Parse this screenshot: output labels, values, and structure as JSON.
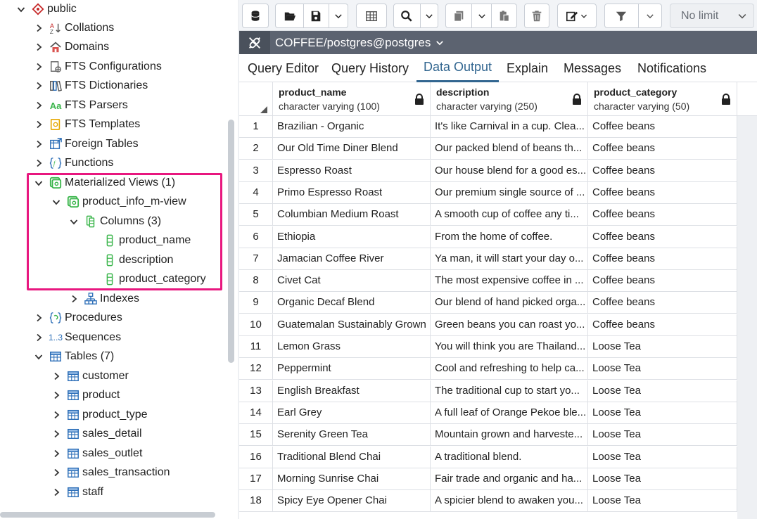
{
  "tree": {
    "items": [
      {
        "label": "public",
        "icon": "schema-icon"
      },
      {
        "label": "Collations",
        "icon": "collation-icon"
      },
      {
        "label": "Domains",
        "icon": "domain-icon"
      },
      {
        "label": "FTS Configurations",
        "icon": "fts-config-icon"
      },
      {
        "label": "FTS Dictionaries",
        "icon": "fts-dictionary-icon"
      },
      {
        "label": "FTS Parsers",
        "icon": "fts-parser-icon"
      },
      {
        "label": "FTS Templates",
        "icon": "fts-template-icon"
      },
      {
        "label": "Foreign Tables",
        "icon": "foreign-table-icon"
      },
      {
        "label": "Functions",
        "icon": "function-icon"
      },
      {
        "label": "Materialized Views (1)",
        "icon": "materialized-view-icon"
      },
      {
        "label": "product_info_m-view",
        "icon": "materialized-view-icon"
      },
      {
        "label": "Columns (3)",
        "icon": "columns-icon"
      },
      {
        "label": "product_name",
        "icon": "column-icon"
      },
      {
        "label": "description",
        "icon": "column-icon"
      },
      {
        "label": "product_category",
        "icon": "column-icon"
      },
      {
        "label": "Indexes",
        "icon": "index-icon"
      },
      {
        "label": "Procedures",
        "icon": "procedure-icon"
      },
      {
        "label": "Sequences",
        "icon": "sequence-icon"
      },
      {
        "label": "Tables (7)",
        "icon": "table-icon"
      },
      {
        "label": "customer",
        "icon": "table-icon"
      },
      {
        "label": "product",
        "icon": "table-icon"
      },
      {
        "label": "product_type",
        "icon": "table-icon"
      },
      {
        "label": "sales_detail",
        "icon": "table-icon"
      },
      {
        "label": "sales_outlet",
        "icon": "table-icon"
      },
      {
        "label": "sales_transaction",
        "icon": "table-icon"
      },
      {
        "label": "staff",
        "icon": "table-icon"
      }
    ],
    "fts_parsers_glyph": "Aa",
    "sequences_glyph": "1..3"
  },
  "toolbar": {
    "limit": "No limit"
  },
  "connection": {
    "label": "COFFEE/postgres@postgres"
  },
  "tabs": [
    "Query Editor",
    "Query History",
    "Data Output",
    "Explain",
    "Messages",
    "Notifications"
  ],
  "active_tab": "Data Output",
  "grid": {
    "columns": [
      {
        "name": "product_name",
        "type": "character varying (100)"
      },
      {
        "name": "description",
        "type": "character varying (250)"
      },
      {
        "name": "product_category",
        "type": "character varying (50)"
      }
    ],
    "rows": [
      [
        "1",
        "Brazilian - Organic",
        "It's like Carnival in a cup. Clea...",
        "Coffee beans"
      ],
      [
        "2",
        "Our Old Time Diner Blend",
        "Our packed blend of beans th...",
        "Coffee beans"
      ],
      [
        "3",
        "Espresso Roast",
        "Our house blend for a good es...",
        "Coffee beans"
      ],
      [
        "4",
        "Primo Espresso Roast",
        "Our premium single source of ...",
        "Coffee beans"
      ],
      [
        "5",
        "Columbian Medium Roast",
        "A smooth cup of coffee any ti...",
        "Coffee beans"
      ],
      [
        "6",
        "Ethiopia",
        "From the home of coffee.",
        "Coffee beans"
      ],
      [
        "7",
        "Jamacian Coffee River",
        "Ya man, it will start your day o...",
        "Coffee beans"
      ],
      [
        "8",
        "Civet Cat",
        "The most expensive coffee in ...",
        "Coffee beans"
      ],
      [
        "9",
        "Organic Decaf Blend",
        "Our blend of hand picked orga...",
        "Coffee beans"
      ],
      [
        "10",
        "Guatemalan Sustainably Grown",
        "Green beans you can roast yo...",
        "Coffee beans"
      ],
      [
        "11",
        "Lemon Grass",
        "You will think you are Thailand...",
        "Loose Tea"
      ],
      [
        "12",
        "Peppermint",
        "Cool and refreshing to help ca...",
        "Loose Tea"
      ],
      [
        "13",
        "English Breakfast",
        "The traditional cup to start yo...",
        "Loose Tea"
      ],
      [
        "14",
        "Earl Grey",
        "A full leaf of Orange Pekoe ble...",
        "Loose Tea"
      ],
      [
        "15",
        "Serenity Green Tea",
        "Mountain grown and harveste...",
        "Loose Tea"
      ],
      [
        "16",
        "Traditional Blend Chai",
        "A traditional blend.",
        "Loose Tea"
      ],
      [
        "17",
        "Morning Sunrise Chai",
        "Fair trade and organic and ha...",
        "Loose Tea"
      ],
      [
        "18",
        "Spicy Eye Opener Chai",
        "A spicier blend to awaken you...",
        "Loose Tea"
      ]
    ]
  },
  "colors": {
    "accent": "#326690",
    "highlight": "#e8177f",
    "connection_bar": "#5c6370",
    "tree_icon_green": "#39b54a",
    "tree_icon_blue": "#2d6fb8"
  }
}
